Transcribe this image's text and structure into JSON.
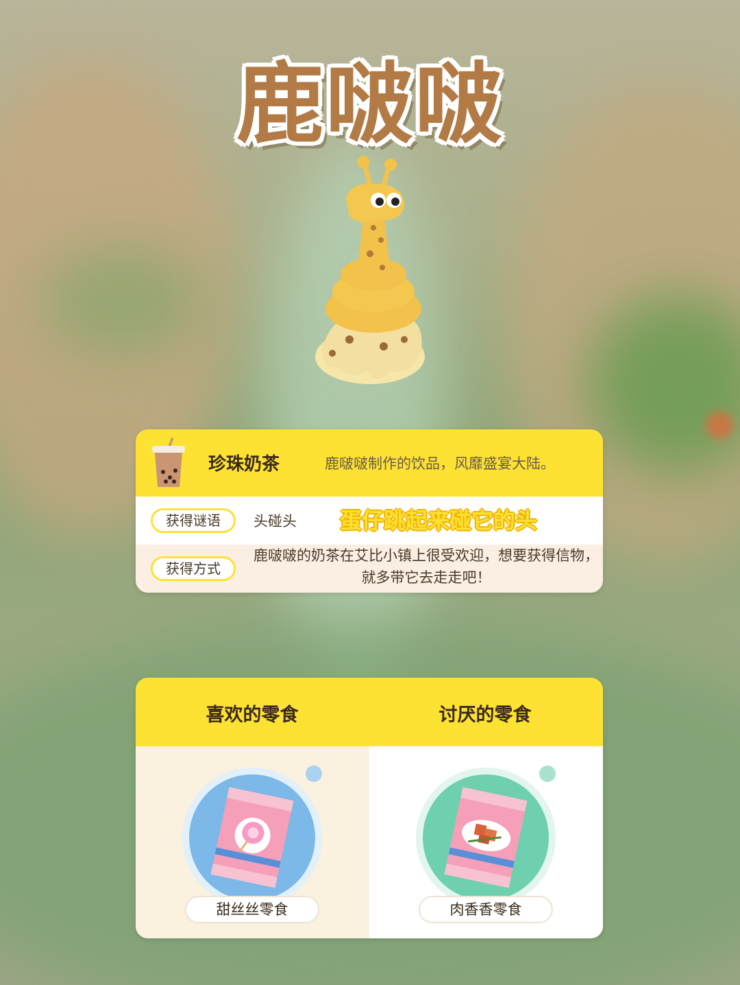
{
  "page": {
    "title": "鹿啵啵"
  },
  "item": {
    "name": "珍珠奶茶",
    "description": "鹿啵啵制作的饮品，风靡盛宴大陆。",
    "riddle_label": "获得谜语",
    "riddle": "头碰头",
    "riddle_hint": "蛋仔跳起来碰它的头",
    "method_label": "获得方式",
    "method": "鹿啵啵的奶茶在艾比小镇上很受欢迎，想要获得信物，就多带它去走走吧！"
  },
  "snacks": {
    "liked_title": "喜欢的零食",
    "disliked_title": "讨厌的零食",
    "liked_item": "甜丝丝零食",
    "disliked_item": "肉香香零食"
  },
  "colors": {
    "accent_yellow": "#fde233",
    "title_brown": "#b27a45",
    "liked_bubble": "#7cb8e8",
    "disliked_bubble": "#6fd0b0"
  }
}
